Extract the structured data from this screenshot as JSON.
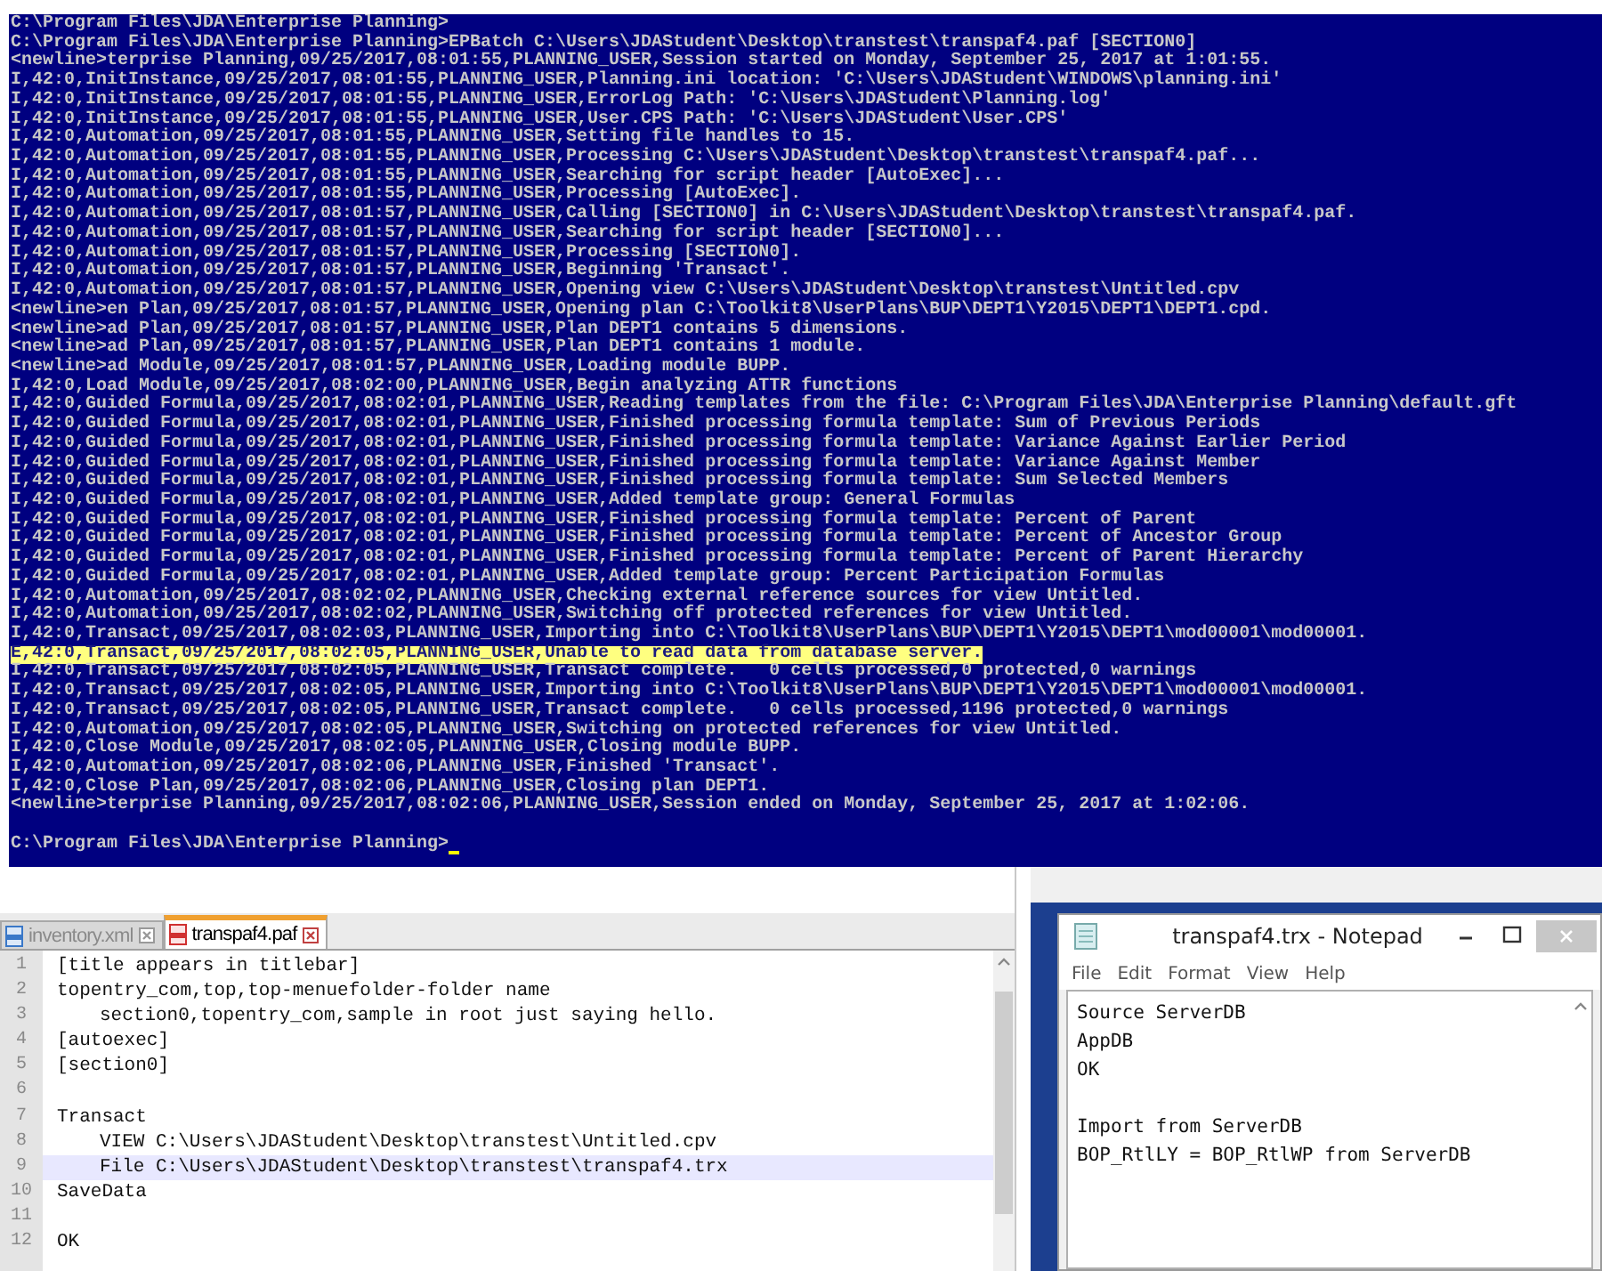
{
  "console": {
    "lines": [
      {
        "text": "C:\\Program Files\\JDA\\Enterprise Planning>",
        "highlighted": false
      },
      {
        "text": "C:\\Program Files\\JDA\\Enterprise Planning>EPBatch C:\\Users\\JDAStudent\\Desktop\\transtest\\transpaf4.paf [SECTION0]",
        "highlighted": false
      },
      {
        "text": "<newline>terprise Planning,09/25/2017,08:01:55,PLANNING_USER,Session started on Monday, September 25, 2017 at 1:01:55.",
        "highlighted": false
      },
      {
        "text": "I,42:0,InitInstance,09/25/2017,08:01:55,PLANNING_USER,Planning.ini location: 'C:\\Users\\JDAStudent\\WINDOWS\\planning.ini'",
        "highlighted": false
      },
      {
        "text": "I,42:0,InitInstance,09/25/2017,08:01:55,PLANNING_USER,ErrorLog Path: 'C:\\Users\\JDAStudent\\Planning.log'",
        "highlighted": false
      },
      {
        "text": "I,42:0,InitInstance,09/25/2017,08:01:55,PLANNING_USER,User.CPS Path: 'C:\\Users\\JDAStudent\\User.CPS'",
        "highlighted": false
      },
      {
        "text": "I,42:0,Automation,09/25/2017,08:01:55,PLANNING_USER,Setting file handles to 15.",
        "highlighted": false
      },
      {
        "text": "I,42:0,Automation,09/25/2017,08:01:55,PLANNING_USER,Processing C:\\Users\\JDAStudent\\Desktop\\transtest\\transpaf4.paf...",
        "highlighted": false
      },
      {
        "text": "I,42:0,Automation,09/25/2017,08:01:55,PLANNING_USER,Searching for script header [AutoExec]...",
        "highlighted": false
      },
      {
        "text": "I,42:0,Automation,09/25/2017,08:01:55,PLANNING_USER,Processing [AutoExec].",
        "highlighted": false
      },
      {
        "text": "I,42:0,Automation,09/25/2017,08:01:57,PLANNING_USER,Calling [SECTION0] in C:\\Users\\JDAStudent\\Desktop\\transtest\\transpaf4.paf.",
        "highlighted": false
      },
      {
        "text": "I,42:0,Automation,09/25/2017,08:01:57,PLANNING_USER,Searching for script header [SECTION0]...",
        "highlighted": false
      },
      {
        "text": "I,42:0,Automation,09/25/2017,08:01:57,PLANNING_USER,Processing [SECTION0].",
        "highlighted": false
      },
      {
        "text": "I,42:0,Automation,09/25/2017,08:01:57,PLANNING_USER,Beginning 'Transact'.",
        "highlighted": false
      },
      {
        "text": "I,42:0,Automation,09/25/2017,08:01:57,PLANNING_USER,Opening view C:\\Users\\JDAStudent\\Desktop\\transtest\\Untitled.cpv",
        "highlighted": false
      },
      {
        "text": "<newline>en Plan,09/25/2017,08:01:57,PLANNING_USER,Opening plan C:\\Toolkit8\\UserPlans\\BUP\\DEPT1\\Y2015\\DEPT1\\DEPT1.cpd.",
        "highlighted": false
      },
      {
        "text": "<newline>ad Plan,09/25/2017,08:01:57,PLANNING_USER,Plan DEPT1 contains 5 dimensions.",
        "highlighted": false
      },
      {
        "text": "<newline>ad Plan,09/25/2017,08:01:57,PLANNING_USER,Plan DEPT1 contains 1 module.",
        "highlighted": false
      },
      {
        "text": "<newline>ad Module,09/25/2017,08:01:57,PLANNING_USER,Loading module BUPP.",
        "highlighted": false
      },
      {
        "text": "I,42:0,Load Module,09/25/2017,08:02:00,PLANNING_USER,Begin analyzing ATTR functions",
        "highlighted": false
      },
      {
        "text": "I,42:0,Guided Formula,09/25/2017,08:02:01,PLANNING_USER,Reading templates from the file: C:\\Program Files\\JDA\\Enterprise Planning\\default.gft",
        "highlighted": false
      },
      {
        "text": "I,42:0,Guided Formula,09/25/2017,08:02:01,PLANNING_USER,Finished processing formula template: Sum of Previous Periods",
        "highlighted": false
      },
      {
        "text": "I,42:0,Guided Formula,09/25/2017,08:02:01,PLANNING_USER,Finished processing formula template: Variance Against Earlier Period",
        "highlighted": false
      },
      {
        "text": "I,42:0,Guided Formula,09/25/2017,08:02:01,PLANNING_USER,Finished processing formula template: Variance Against Member",
        "highlighted": false
      },
      {
        "text": "I,42:0,Guided Formula,09/25/2017,08:02:01,PLANNING_USER,Finished processing formula template: Sum Selected Members",
        "highlighted": false
      },
      {
        "text": "I,42:0,Guided Formula,09/25/2017,08:02:01,PLANNING_USER,Added template group: General Formulas",
        "highlighted": false
      },
      {
        "text": "I,42:0,Guided Formula,09/25/2017,08:02:01,PLANNING_USER,Finished processing formula template: Percent of Parent",
        "highlighted": false
      },
      {
        "text": "I,42:0,Guided Formula,09/25/2017,08:02:01,PLANNING_USER,Finished processing formula template: Percent of Ancestor Group",
        "highlighted": false
      },
      {
        "text": "I,42:0,Guided Formula,09/25/2017,08:02:01,PLANNING_USER,Finished processing formula template: Percent of Parent Hierarchy",
        "highlighted": false
      },
      {
        "text": "I,42:0,Guided Formula,09/25/2017,08:02:01,PLANNING_USER,Added template group: Percent Participation Formulas",
        "highlighted": false
      },
      {
        "text": "I,42:0,Automation,09/25/2017,08:02:02,PLANNING_USER,Checking external reference sources for view Untitled.",
        "highlighted": false
      },
      {
        "text": "I,42:0,Automation,09/25/2017,08:02:02,PLANNING_USER,Switching off protected references for view Untitled.",
        "highlighted": false
      },
      {
        "text": "I,42:0,Transact,09/25/2017,08:02:03,PLANNING_USER,Importing into C:\\Toolkit8\\UserPlans\\BUP\\DEPT1\\Y2015\\DEPT1\\mod00001\\mod00001.",
        "highlighted": false
      },
      {
        "text": "E,42:0,Transact,09/25/2017,08:02:05,PLANNING_USER,Unable to read data from database server.",
        "highlighted": true
      },
      {
        "text": "I,42:0,Transact,09/25/2017,08:02:05,PLANNING_USER,Transact complete.   0 cells processed,0 protected,0 warnings",
        "highlighted": false
      },
      {
        "text": "I,42:0,Transact,09/25/2017,08:02:05,PLANNING_USER,Importing into C:\\Toolkit8\\UserPlans\\BUP\\DEPT1\\Y2015\\DEPT1\\mod00001\\mod00001.",
        "highlighted": false
      },
      {
        "text": "I,42:0,Transact,09/25/2017,08:02:05,PLANNING_USER,Transact complete.   0 cells processed,1196 protected,0 warnings",
        "highlighted": false
      },
      {
        "text": "I,42:0,Automation,09/25/2017,08:02:05,PLANNING_USER,Switching on protected references for view Untitled.",
        "highlighted": false
      },
      {
        "text": "I,42:0,Close Module,09/25/2017,08:02:05,PLANNING_USER,Closing module BUPP.",
        "highlighted": false
      },
      {
        "text": "I,42:0,Automation,09/25/2017,08:02:06,PLANNING_USER,Finished 'Transact'.",
        "highlighted": false
      },
      {
        "text": "I,42:0,Close Plan,09/25/2017,08:02:06,PLANNING_USER,Closing plan DEPT1.",
        "highlighted": false
      },
      {
        "text": "<newline>terprise Planning,09/25/2017,08:02:06,PLANNING_USER,Session ended on Monday, September 25, 2017 at 1:02:06.",
        "highlighted": false
      }
    ],
    "prompt": "C:\\Program Files\\JDA\\Enterprise Planning>"
  },
  "editor": {
    "tabs": [
      {
        "label": "inventory.xml",
        "selected": false
      },
      {
        "label": "transpaf4.paf",
        "selected": true
      }
    ],
    "lines": [
      {
        "number": "1",
        "text": "[title appears in titlebar]",
        "current": false
      },
      {
        "number": "2",
        "text": "topentry_com,top,top-menuefolder-folder name",
        "current": false,
        "children": [
          {
            "number": "3",
            "text": "section0,topentry_com,sample in root just saying hello.",
            "current": false
          }
        ]
      },
      {
        "number": "4",
        "text": "[autoexec]",
        "current": false
      },
      {
        "number": "5",
        "text": "[section0]",
        "current": false
      },
      {
        "number": "6",
        "current": false
      },
      {
        "number": "7",
        "text": "Transact",
        "current": false,
        "children": [
          {
            "number": "8",
            "text": "VIEW C:\\Users\\JDAStudent\\Desktop\\transtest\\Untitled.cpv",
            "current": false
          },
          {
            "number": "9",
            "text": "File C:\\Users\\JDAStudent\\Desktop\\transtest\\transpaf4.trx",
            "current": true
          }
        ]
      },
      {
        "number": "10",
        "text": "SaveData",
        "current": false
      },
      {
        "number": "11",
        "current": false
      },
      {
        "number": "12",
        "text": "OK",
        "current": false
      }
    ]
  },
  "notepad": {
    "title": "transpaf4.trx - Notepad",
    "menu": [
      "File",
      "Edit",
      "Format",
      "View",
      "Help"
    ],
    "paragraphs": [
      [
        "Source ServerDB",
        "AppDB",
        "OK"
      ],
      [
        "Import from ServerDB",
        "BOP_RtlLY = BOP_RtlWP from ServerDB"
      ]
    ]
  }
}
